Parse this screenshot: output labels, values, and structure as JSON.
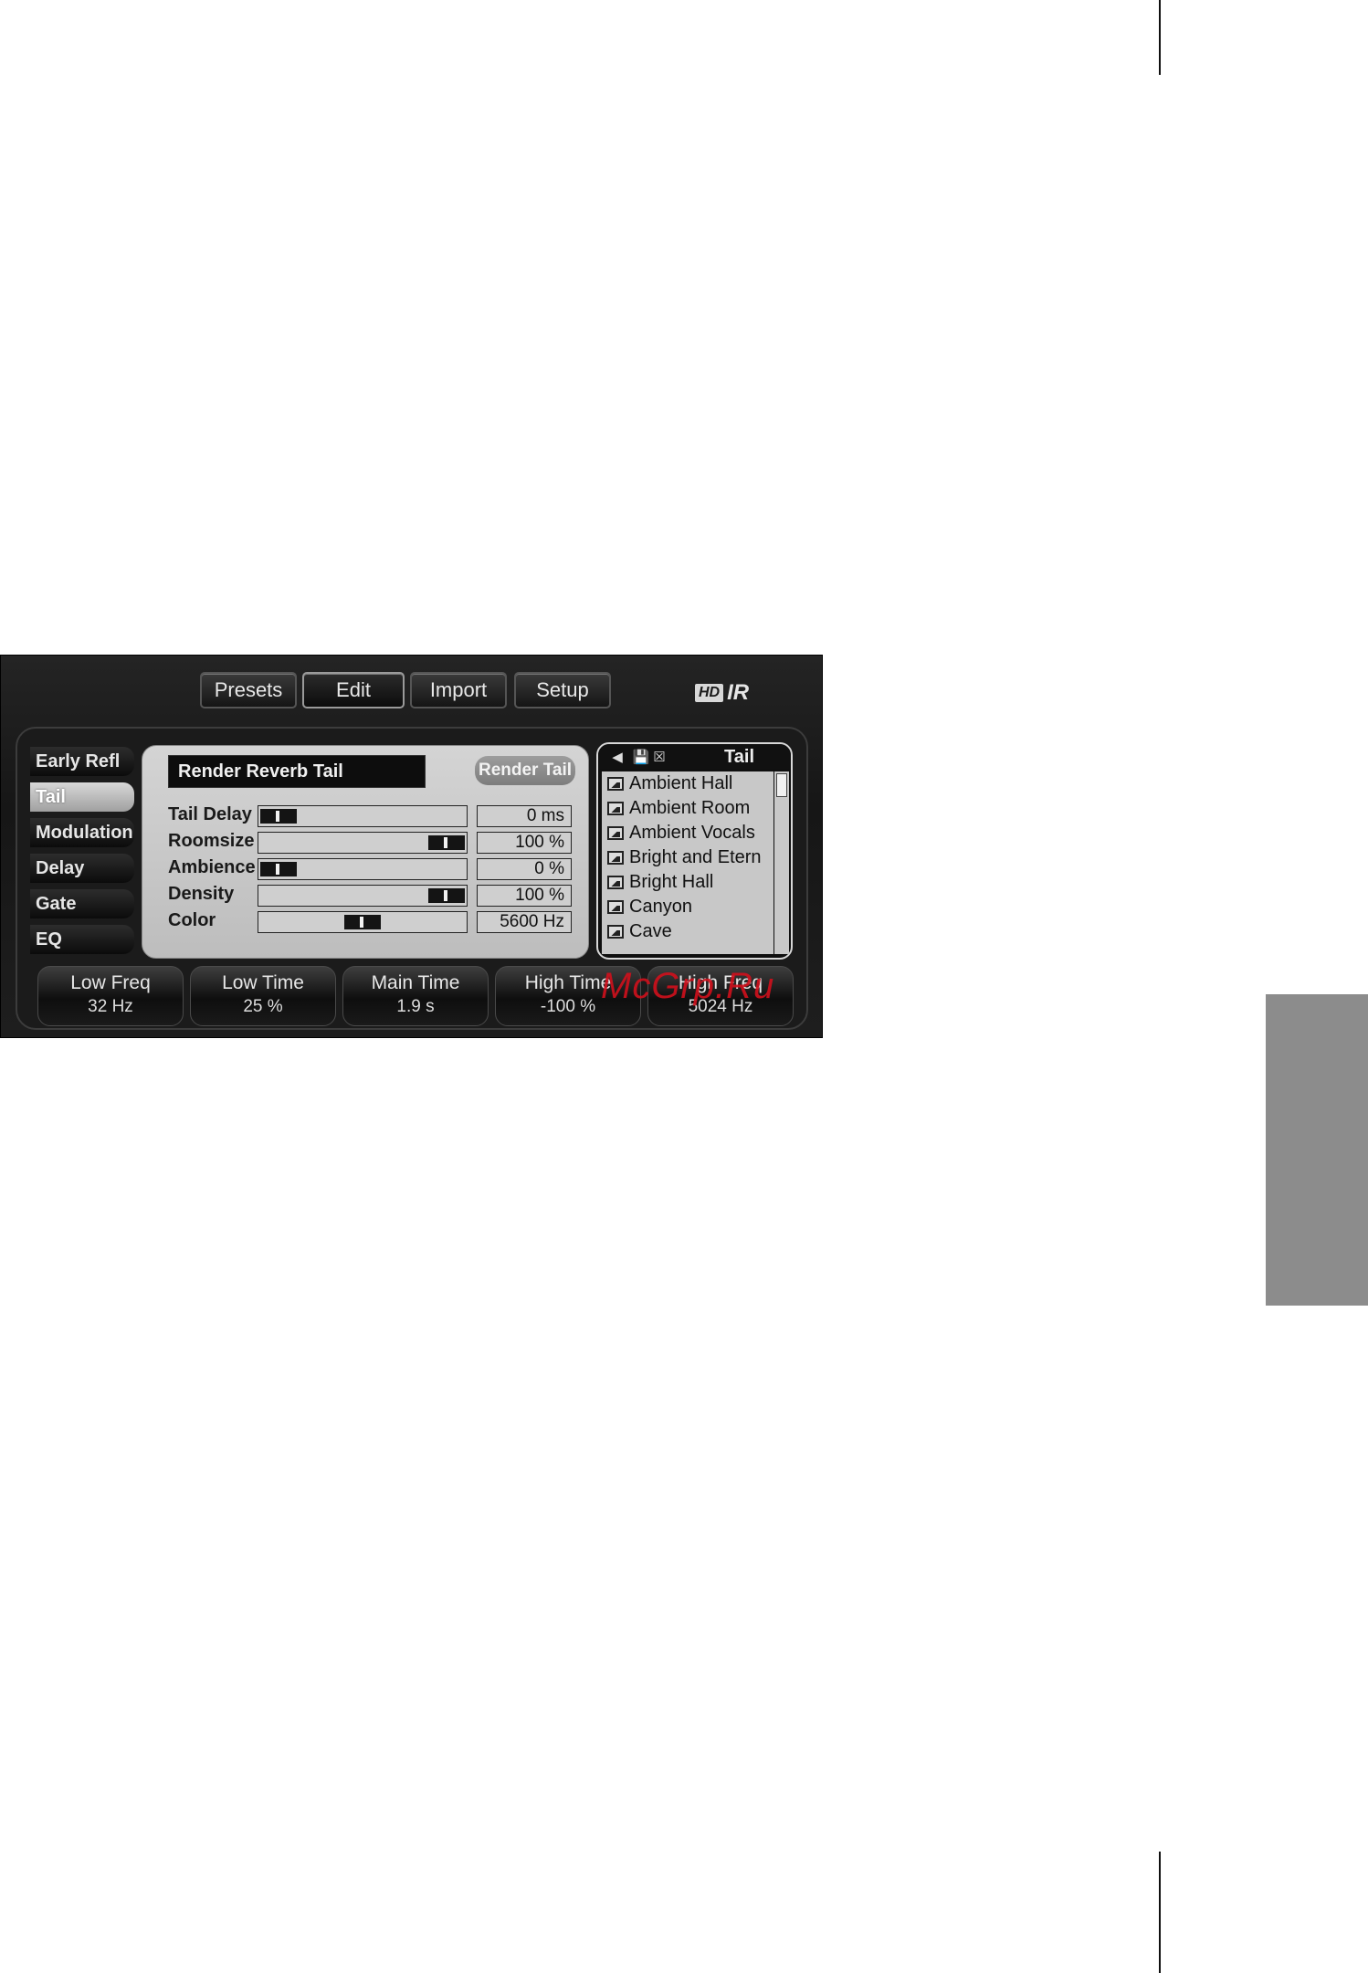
{
  "toolbar": {
    "presets": "Presets",
    "edit": "Edit",
    "import": "Import",
    "setup": "Setup"
  },
  "logo": {
    "hd": "HD",
    "ir": "IR"
  },
  "sidebar": {
    "items": [
      {
        "label": "Early Refl"
      },
      {
        "label": "Tail"
      },
      {
        "label": "Modulation"
      },
      {
        "label": "Delay"
      },
      {
        "label": "Gate"
      },
      {
        "label": "EQ"
      }
    ],
    "active": "Tail"
  },
  "render": {
    "label": "Render Reverb Tail",
    "button": "Render Tail"
  },
  "params": [
    {
      "label": "Tail Delay",
      "value": "0 ms",
      "position": 0.0
    },
    {
      "label": "Roomsize",
      "value": "100 %",
      "position": 1.0
    },
    {
      "label": "Ambience",
      "value": "0 %",
      "position": 0.0
    },
    {
      "label": "Density",
      "value": "100 %",
      "position": 1.0
    },
    {
      "label": "Color",
      "value": "5600 Hz",
      "position": 0.5
    }
  ],
  "presets_panel": {
    "title": "Tail",
    "icons": [
      "back-icon",
      "save-icon",
      "close-icon"
    ],
    "items": [
      "Ambient Hall",
      "Ambient Room",
      "Ambient Vocals",
      "Bright and Etern",
      "Bright Hall",
      "Canyon",
      "Cave"
    ]
  },
  "knobs": [
    {
      "label": "Low Freq",
      "value": "32 Hz"
    },
    {
      "label": "Low Time",
      "value": "25 %"
    },
    {
      "label": "Main Time",
      "value": "1.9 s"
    },
    {
      "label": "High Time",
      "value": "-100 %"
    },
    {
      "label": "High Freq",
      "value": "5024 Hz"
    }
  ],
  "watermark": "McGrp.Ru"
}
